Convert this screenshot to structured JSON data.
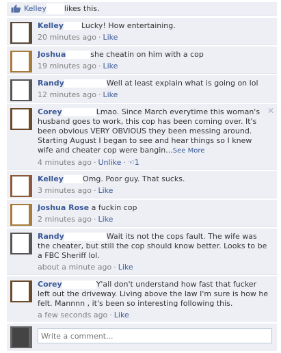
{
  "likes": {
    "name": "Kelley",
    "text": "likes this."
  },
  "comments": [
    {
      "author": "Kelley",
      "text": "Lucky! How entertaining.",
      "time": "20 minutes ago",
      "like": "Like"
    },
    {
      "author": "Joshua",
      "text": "she cheatin on him with a cop",
      "time": "19 minutes ago",
      "like": "Like"
    },
    {
      "author": "Randy",
      "text": "Well at least explain what is going on lol",
      "time": "12 minutes ago",
      "like": "Like"
    },
    {
      "author": "Corey",
      "text": "Lmao. Since March everytime this woman's husband goes to work, this cop has been coming over. It's been obvious VERY OBVIOUS they been messing around. Starting August I began to see and hear things so I knew wife and cheater cop were bangin...",
      "see_more": "See More",
      "time": "4 minutes ago",
      "like": "Unlike",
      "like_count": "1"
    },
    {
      "author": "Kelley",
      "text": "Omg. Poor guy. That sucks.",
      "time": "3 minutes ago",
      "like": "Like"
    },
    {
      "author": "Joshua Rose",
      "text": "a fuckin cop",
      "time": "2 minutes ago",
      "like": "Like"
    },
    {
      "author": "Randy",
      "text": "Wait its not the cops fault. The wife was the cheater, but still the cop should know better. Looks to be a FBC Sheriff lol.",
      "time": "about a minute ago",
      "like": "Like"
    },
    {
      "author": "Corey",
      "text": "Y'all don't understand how fast that fucker left out the driveway. Living above the law I'm sure is how he felt. Mannnn , it's been so interesting following this.",
      "time": "a few seconds ago",
      "like": "Like"
    }
  ],
  "write_placeholder": "Write a comment...",
  "close_glyph": "✕",
  "thumb_glyph": "👍"
}
